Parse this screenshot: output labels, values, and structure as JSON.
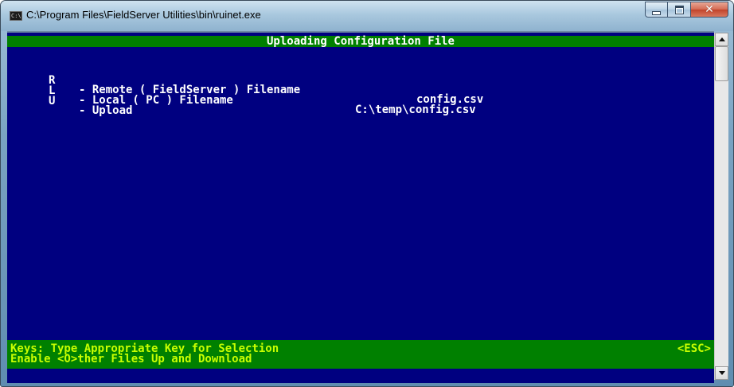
{
  "window": {
    "title": "C:\\Program Files\\FieldServer Utilities\\bin\\ruinet.exe",
    "icon": "cmd-console-icon",
    "icon_text": "C:\\",
    "buttons": {
      "minimize": "minimize-icon",
      "maximize": "maximize-icon",
      "close": "✕"
    }
  },
  "console": {
    "header": "Uploading Configuration File",
    "menu": [
      {
        "key": "R",
        "label": "- Remote ( FieldServer ) Filename",
        "value": "config.csv"
      },
      {
        "key": "L",
        "label": "- Local ( PC ) Filename",
        "value": "C:\\temp\\config.csv"
      },
      {
        "key": "U",
        "label": "- Upload",
        "value": ""
      }
    ],
    "footer": {
      "line1": "Keys: Type Appropriate Key for Selection",
      "esc": "<ESC>",
      "line2": "Enable <O>ther Files Up and Download"
    }
  },
  "colors": {
    "console_bg": "#000080",
    "bar_bg": "#008000",
    "header_text": "#ffffff",
    "footer_text": "#c8ff00"
  }
}
